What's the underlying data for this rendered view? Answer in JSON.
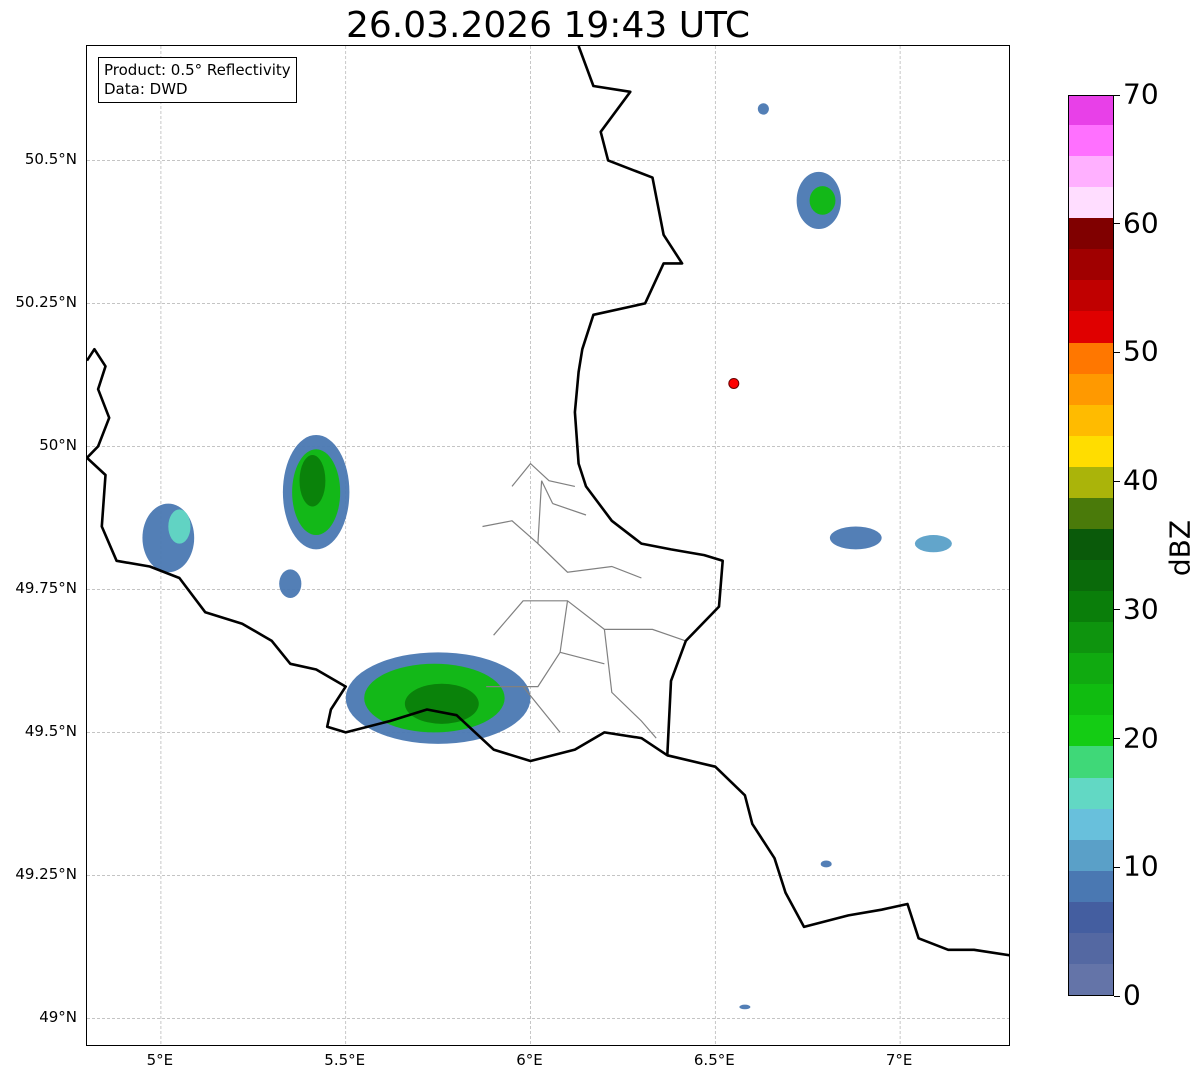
{
  "title": "26.03.2026 19:43 UTC",
  "info_box": {
    "product": "Product: 0.5° Reflectivity",
    "data": "Data: DWD"
  },
  "map": {
    "lat_range": [
      48.95,
      50.7
    ],
    "lon_range": [
      4.8,
      7.3
    ],
    "lat_ticks": [
      {
        "value": 49.0,
        "label": "49°N"
      },
      {
        "value": 49.25,
        "label": "49.25°N"
      },
      {
        "value": 49.5,
        "label": "49.5°N"
      },
      {
        "value": 49.75,
        "label": "49.75°N"
      },
      {
        "value": 50.0,
        "label": "50°N"
      },
      {
        "value": 50.25,
        "label": "50.25°N"
      },
      {
        "value": 50.5,
        "label": "50.5°N"
      }
    ],
    "lon_ticks": [
      {
        "value": 5.0,
        "label": "5°E"
      },
      {
        "value": 5.5,
        "label": "5.5°E"
      },
      {
        "value": 6.0,
        "label": "6°E"
      },
      {
        "value": 6.5,
        "label": "6.5°E"
      },
      {
        "value": 7.0,
        "label": "7°E"
      }
    ],
    "gridlines": true,
    "radar_site": {
      "lon": 6.55,
      "lat": 50.11,
      "color": "#ff0000"
    },
    "borders": {
      "national": [
        [
          [
            6.13,
            50.7
          ],
          [
            6.17,
            50.63
          ],
          [
            6.27,
            50.62
          ],
          [
            6.19,
            50.55
          ],
          [
            6.21,
            50.5
          ],
          [
            6.33,
            50.47
          ],
          [
            6.36,
            50.37
          ],
          [
            6.41,
            50.32
          ],
          [
            6.36,
            50.32
          ],
          [
            6.31,
            50.25
          ],
          [
            6.17,
            50.23
          ],
          [
            6.14,
            50.17
          ],
          [
            6.13,
            50.13
          ],
          [
            6.12,
            50.06
          ],
          [
            6.13,
            49.97
          ],
          [
            6.15,
            49.93
          ],
          [
            6.22,
            49.87
          ],
          [
            6.3,
            49.83
          ],
          [
            6.38,
            49.82
          ],
          [
            6.47,
            49.81
          ],
          [
            6.52,
            49.8
          ],
          [
            6.51,
            49.72
          ],
          [
            6.42,
            49.66
          ],
          [
            6.38,
            49.59
          ],
          [
            6.37,
            49.46
          ],
          [
            6.3,
            49.49
          ],
          [
            6.2,
            49.5
          ],
          [
            6.12,
            49.47
          ],
          [
            6.0,
            49.45
          ],
          [
            5.9,
            49.47
          ],
          [
            5.8,
            49.53
          ],
          [
            5.72,
            49.54
          ],
          [
            5.62,
            49.52
          ],
          [
            5.5,
            49.5
          ],
          [
            5.45,
            49.51
          ],
          [
            5.46,
            49.54
          ],
          [
            5.5,
            49.58
          ],
          [
            5.42,
            49.61
          ],
          [
            5.35,
            49.62
          ],
          [
            5.3,
            49.66
          ],
          [
            5.22,
            49.69
          ],
          [
            5.12,
            49.71
          ],
          [
            5.05,
            49.77
          ],
          [
            4.97,
            49.79
          ],
          [
            4.88,
            49.8
          ],
          [
            4.84,
            49.86
          ],
          [
            4.85,
            49.95
          ],
          [
            4.8,
            49.98
          ]
        ],
        [
          [
            6.37,
            49.46
          ],
          [
            6.5,
            49.44
          ],
          [
            6.58,
            49.39
          ],
          [
            6.6,
            49.34
          ],
          [
            6.66,
            49.28
          ],
          [
            6.69,
            49.22
          ],
          [
            6.74,
            49.16
          ],
          [
            6.86,
            49.18
          ],
          [
            6.95,
            49.19
          ],
          [
            7.02,
            49.2
          ],
          [
            7.05,
            49.14
          ],
          [
            7.13,
            49.12
          ],
          [
            7.2,
            49.12
          ],
          [
            7.3,
            49.11
          ]
        ],
        [
          [
            4.8,
            50.15
          ],
          [
            4.82,
            50.17
          ],
          [
            4.85,
            50.14
          ],
          [
            4.83,
            50.1
          ],
          [
            4.86,
            50.05
          ],
          [
            4.83,
            50.0
          ],
          [
            4.8,
            49.98
          ]
        ]
      ],
      "district": [
        [
          [
            5.95,
            49.93
          ],
          [
            6.0,
            49.97
          ],
          [
            6.05,
            49.94
          ],
          [
            6.12,
            49.93
          ]
        ],
        [
          [
            6.03,
            49.94
          ],
          [
            6.02,
            49.83
          ],
          [
            6.1,
            49.78
          ],
          [
            6.22,
            49.79
          ],
          [
            6.3,
            49.77
          ]
        ],
        [
          [
            5.87,
            49.86
          ],
          [
            5.95,
            49.87
          ],
          [
            6.02,
            49.83
          ]
        ],
        [
          [
            5.9,
            49.67
          ],
          [
            5.98,
            49.73
          ],
          [
            6.1,
            49.73
          ],
          [
            6.2,
            49.68
          ],
          [
            6.33,
            49.68
          ],
          [
            6.42,
            49.66
          ]
        ],
        [
          [
            6.1,
            49.73
          ],
          [
            6.08,
            49.64
          ],
          [
            6.02,
            49.58
          ],
          [
            5.88,
            49.58
          ]
        ],
        [
          [
            6.2,
            49.68
          ],
          [
            6.22,
            49.57
          ],
          [
            6.3,
            49.52
          ],
          [
            6.34,
            49.49
          ]
        ],
        [
          [
            6.06,
            49.9
          ],
          [
            6.03,
            49.94
          ]
        ],
        [
          [
            6.08,
            49.64
          ],
          [
            6.2,
            49.62
          ]
        ],
        [
          [
            6.15,
            49.88
          ],
          [
            6.06,
            49.9
          ]
        ],
        [
          [
            5.98,
            49.58
          ],
          [
            6.08,
            49.5
          ]
        ]
      ]
    },
    "echo_cells": [
      {
        "lon": 5.42,
        "lat": 49.92,
        "rx": 0.09,
        "ry": 0.1,
        "dbz": 8
      },
      {
        "lon": 5.42,
        "lat": 49.92,
        "rx": 0.065,
        "ry": 0.075,
        "dbz": 22
      },
      {
        "lon": 5.41,
        "lat": 49.94,
        "rx": 0.035,
        "ry": 0.045,
        "dbz": 31
      },
      {
        "lon": 5.02,
        "lat": 49.84,
        "rx": 0.07,
        "ry": 0.06,
        "dbz": 9
      },
      {
        "lon": 5.05,
        "lat": 49.86,
        "rx": 0.03,
        "ry": 0.03,
        "dbz": 15
      },
      {
        "lon": 5.35,
        "lat": 49.76,
        "rx": 0.03,
        "ry": 0.025,
        "dbz": 8
      },
      {
        "lon": 5.75,
        "lat": 49.56,
        "rx": 0.25,
        "ry": 0.08,
        "dbz": 8
      },
      {
        "lon": 5.74,
        "lat": 49.56,
        "rx": 0.19,
        "ry": 0.06,
        "dbz": 22
      },
      {
        "lon": 5.76,
        "lat": 49.55,
        "rx": 0.1,
        "ry": 0.035,
        "dbz": 30
      },
      {
        "lon": 6.78,
        "lat": 50.43,
        "rx": 0.06,
        "ry": 0.05,
        "dbz": 9
      },
      {
        "lon": 6.79,
        "lat": 50.43,
        "rx": 0.035,
        "ry": 0.025,
        "dbz": 22
      },
      {
        "lon": 6.88,
        "lat": 49.84,
        "rx": 0.07,
        "ry": 0.02,
        "dbz": 8
      },
      {
        "lon": 7.09,
        "lat": 49.83,
        "rx": 0.05,
        "ry": 0.015,
        "dbz": 12
      },
      {
        "lon": 6.63,
        "lat": 50.59,
        "rx": 0.015,
        "ry": 0.01,
        "dbz": 8
      },
      {
        "lon": 6.8,
        "lat": 49.27,
        "rx": 0.015,
        "ry": 0.006,
        "dbz": 8
      },
      {
        "lon": 6.58,
        "lat": 49.02,
        "rx": 0.015,
        "ry": 0.004,
        "dbz": 8
      }
    ]
  },
  "colorbar": {
    "label": "dBZ",
    "min": 0,
    "max": 70,
    "tick_labels": [
      {
        "value": 0,
        "label": "0"
      },
      {
        "value": 10,
        "label": "10"
      },
      {
        "value": 20,
        "label": "20"
      },
      {
        "value": 30,
        "label": "30"
      },
      {
        "value": 40,
        "label": "40"
      },
      {
        "value": 50,
        "label": "50"
      },
      {
        "value": 60,
        "label": "60"
      },
      {
        "value": 70,
        "label": "70"
      }
    ],
    "colors": [
      "#6474a8",
      "#5468a2",
      "#445ea0",
      "#4a78b2",
      "#5aa0c8",
      "#68c0dc",
      "#62d8c4",
      "#3fd878",
      "#14cc14",
      "#10bc10",
      "#10aa10",
      "#0e940e",
      "#0a7e0a",
      "#0a6a0a",
      "#0a5a0a",
      "#4a7a0a",
      "#aab40a",
      "#ffdd00",
      "#ffbb00",
      "#ff9900",
      "#ff7700",
      "#e00000",
      "#c00000",
      "#a00000",
      "#800000",
      "#ffddff",
      "#ffb0ff",
      "#ff70ff",
      "#e840e8"
    ]
  }
}
